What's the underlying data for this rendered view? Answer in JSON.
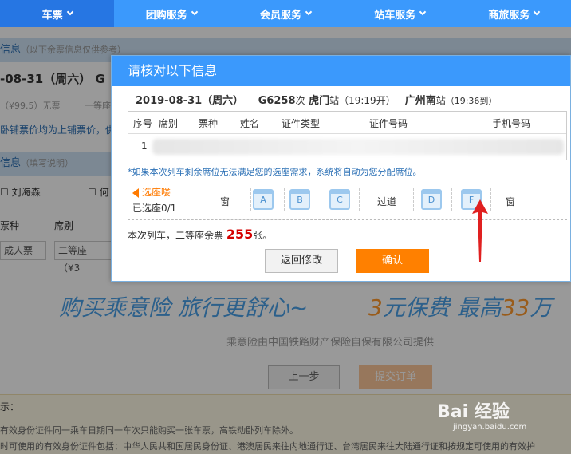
{
  "nav": {
    "items": [
      {
        "label": "车票",
        "active": true
      },
      {
        "label": "团购服务",
        "active": false
      },
      {
        "label": "会员服务",
        "active": false
      },
      {
        "label": "站车服务",
        "active": false
      },
      {
        "label": "商旅服务",
        "active": false
      }
    ]
  },
  "background": {
    "section1_title": "信息",
    "section1_note": "（以下余票信息仅供参考）",
    "date_partial": "-08-31（周六）  G",
    "price_partial": "（¥99.5）无票",
    "grade_partial": "一等座",
    "sleeper_note_partial": "卧铺票价均为上铺票价，供",
    "section2_title": "信息",
    "section2_note": "（填写说明）",
    "passenger1": "刘海森",
    "passenger2": "何",
    "col_ticket_type": "票种",
    "col_seat_class": "席别",
    "ticket_type_value": "成人票",
    "seat_class_value": "二等座（¥3",
    "promo_left": "购买乘意险  旅行更舒心~",
    "promo_right_a": "3",
    "promo_right_b": "元保费  最高",
    "promo_right_c": "33",
    "promo_right_d": "万",
    "provider": "乘意险由中国铁路财产保险自保有限公司提供",
    "btn_prev": "上一步",
    "btn_submit": "提交订单",
    "tips_title": "示：",
    "tips_line1": "有效身份证件同一乘车日期同一车次只能购买一张车票，高铁动卧列车除外。",
    "tips_line2": "时可使用的有效身份证件包括：中华人民共和国居民身份证、港澳居民来往内地通行证、台湾居民来往大陆通行证和按规定可使用的有效护"
  },
  "dialog": {
    "title": "请核对以下信息",
    "trip": {
      "date": "2019-08-31（周六）",
      "train": "G6258",
      "train_suffix": "次",
      "from": "虎门",
      "from_suffix": "站（19:19开）—",
      "to": "广州南",
      "to_suffix": "站",
      "arrive": "（19:36到）"
    },
    "table": {
      "headers": [
        "序号",
        "席别",
        "票种",
        "姓名",
        "证件类型",
        "证件号码",
        "手机号码"
      ],
      "rows": [
        {
          "index": "1"
        }
      ]
    },
    "notice": "*如果本次列车剩余席位无法满足您的选座需求，系统将自动为您分配席位。",
    "seat_select_label": "选座喽",
    "selected_count": "已选座0/1",
    "window_left": "窗",
    "aisle": "过道",
    "window_right": "窗",
    "seats": [
      "A",
      "B",
      "C",
      "D",
      "F"
    ],
    "remaining_prefix": "本次列车，二等座余票",
    "remaining_count": "255",
    "remaining_suffix": "张。",
    "btn_back": "返回修改",
    "btn_confirm": "确认"
  },
  "colors": {
    "nav_bg": "#3b99fc",
    "nav_active": "#2676e3",
    "confirm": "#ff8000",
    "remaining_count": "#d40000",
    "arrow": "#e02020"
  },
  "watermark": {
    "text": "Bai 经验",
    "sub": "jingyan.baidu.com"
  }
}
